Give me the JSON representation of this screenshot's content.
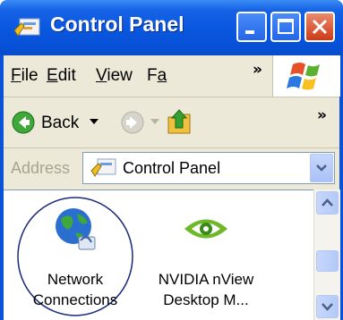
{
  "window": {
    "title": "Control Panel"
  },
  "menu": {
    "items": [
      "File",
      "Edit",
      "View",
      "Fa"
    ],
    "underline": [
      "F",
      "E",
      "V",
      "a"
    ]
  },
  "toolbar": {
    "back_label": "Back"
  },
  "address": {
    "label": "Address",
    "value": "Control Panel"
  },
  "items": [
    {
      "line1": "Network",
      "line2": "Connections",
      "icon": "network-globe-icon"
    },
    {
      "line1": "NVIDIA nView",
      "line2": "Desktop M...",
      "icon": "nvidia-eye-icon"
    }
  ],
  "colors": {
    "titlebar": "#0a58e0",
    "client": "#ece9d8",
    "close": "#cd3b18"
  }
}
